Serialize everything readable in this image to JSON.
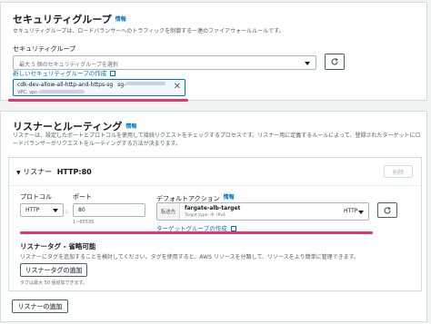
{
  "security_group": {
    "title": "セキュリティグループ",
    "info": "情報",
    "description": "セキュリティグループは、ロードバランサーへのトラフィックを制御する一連のファイアウォールルールです。",
    "field_label": "セキュリティグループ",
    "select_placeholder": "最大 5 個のセキュリティグループを選択",
    "create_link": "新しいセキュリティグループの作成",
    "token_name": "cdk-dev-allow-all-http-and-https-sg",
    "token_id_prefix": "sg-",
    "token_vpc_prefix": "VPC: vpc-"
  },
  "listeners": {
    "title": "リスナーとルーティング",
    "info": "情報",
    "description": "リスナーは、設定したポートとプロトコルを使用して接続リクエストをチェックするプロセスです。リスナー用に定義するルールによって、登録されたターゲットにロードバランサーがリクエストをルーティングする方法が決まります。",
    "listener_title": "リスナー",
    "listener_name": "HTTP:80",
    "remove_button": "削除",
    "protocol_label": "プロトコル",
    "protocol_value": "HTTP",
    "port_label": "ポート",
    "port_value": "80",
    "port_hint": "1~65535",
    "default_action_label": "デフォルトアクション",
    "default_action_info": "情報",
    "forward_label": "転送先",
    "target_name": "fargate-alb-target",
    "target_sub": "Target type: IP, IPv4",
    "target_protocol": "HTTP",
    "create_target_link": "ターゲットグループの作成",
    "tags_title": "リスナータグ - 省略可能",
    "tags_description": "リスナーにタグを追加することを検討してください。タグを使用すると、AWS リソースを分類して、リソースをより簡単に管理できます。",
    "add_tag_button": "リスナータグの追加",
    "tag_hint": "タグは最大 50 個追加できます。",
    "add_listener_button": "リスナーの追加"
  },
  "colors": {
    "link": "#0073bb",
    "highlight": "#e8336f",
    "border": "#aab7b8"
  }
}
